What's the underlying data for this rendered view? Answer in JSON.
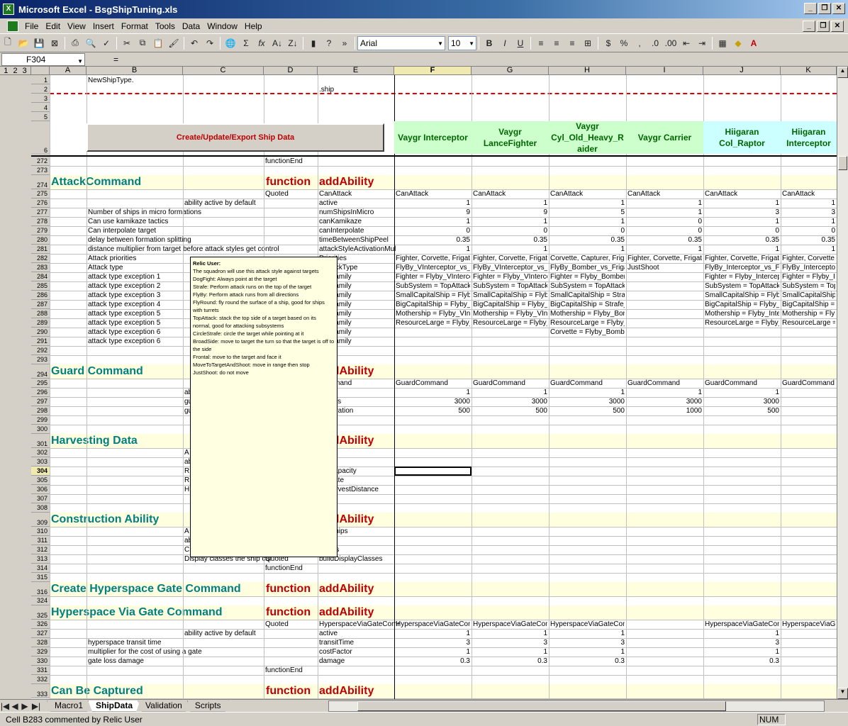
{
  "window": {
    "title": "Microsoft Excel - BsgShipTuning.xls",
    "app_icon": "excel-icon"
  },
  "menu": [
    "File",
    "Edit",
    "View",
    "Insert",
    "Format",
    "Tools",
    "Data",
    "Window",
    "Help"
  ],
  "toolbar": {
    "font": "Arial",
    "size": "10"
  },
  "formula": {
    "namebox": "F304",
    "eq": "="
  },
  "columns": [
    "A",
    "B",
    "C",
    "D",
    "E",
    "F",
    "G",
    "H",
    "I",
    "J",
    "K"
  ],
  "outline_levels": [
    "1",
    "2",
    "3"
  ],
  "header_rows": {
    "r1": "NewShipType.",
    "r2": ".ship"
  },
  "button_label": "Create/Update/Export Ship Data",
  "ships": [
    "Vaygr Interceptor",
    "Vaygr LanceFighter",
    "Vaygr Cyl_Old_Heavy_R aider",
    "Vaygr Carrier",
    "Hiigaran Col_Raptor",
    "Hiigaran Interceptor"
  ],
  "sections": [
    {
      "row": "274",
      "title": "AttackCommand",
      "fn": "function",
      "add": "addAbility"
    },
    {
      "row": "294",
      "title": "Guard Command",
      "fn": "function",
      "add": "addAbility"
    },
    {
      "row": "301",
      "title": "Harvesting Data",
      "fn": "function",
      "add": "addAbility"
    },
    {
      "row": "309",
      "title": "Construction Ability",
      "fn": "function",
      "add": "addAbility"
    },
    {
      "row": "316",
      "title": "Create Hyperspace Gate Command",
      "fn": "function",
      "add": "addAbility"
    },
    {
      "row": "325",
      "title": "Hyperspace Via Gate Command",
      "fn": "function",
      "add": "addAbility"
    },
    {
      "row": "333",
      "title": "Can Be Captured",
      "fn": "function",
      "add": "addAbility"
    }
  ],
  "rows": [
    {
      "n": "272",
      "cells": {
        "D": "functionEnd"
      }
    },
    {
      "n": "273",
      "cells": {}
    },
    {
      "n": "275",
      "cells": {
        "D": "Quoted",
        "E": "CanAttack",
        "F": "CanAttack",
        "G": "CanAttack",
        "H": "CanAttack",
        "I": "CanAttack",
        "J": "CanAttack",
        "K": "CanAttack"
      }
    },
    {
      "n": "276",
      "cells": {
        "C": "ability active by default",
        "E": "active",
        "F": "1",
        "G": "1",
        "H": "1",
        "I": "1",
        "J": "1",
        "K": "1"
      }
    },
    {
      "n": "277",
      "cells": {
        "B": "Number of ships in micro formations",
        "E": "numShipsInMicro",
        "F": "9",
        "G": "9",
        "H": "5",
        "I": "1",
        "J": "3",
        "K": "3"
      }
    },
    {
      "n": "278",
      "cells": {
        "B": "Can use kamikaze tactics",
        "E": "canKamikaze",
        "F": "1",
        "G": "1",
        "H": "1",
        "I": "0",
        "J": "1",
        "K": "1"
      }
    },
    {
      "n": "279",
      "cells": {
        "B": "Can interpolate target",
        "E": "canInterpolate",
        "F": "0",
        "G": "0",
        "H": "0",
        "I": "0",
        "J": "0",
        "K": "0"
      }
    },
    {
      "n": "280",
      "cells": {
        "B": "delay between formation splitting",
        "E": "timeBetweenShipPeel",
        "F": "0.35",
        "G": "0.35",
        "H": "0.35",
        "I": "0.35",
        "J": "0.35",
        "K": "0.35"
      }
    },
    {
      "n": "281",
      "cells": {
        "B": "distance multiplier from target before attack styles get control",
        "E": "attackStyleActivationMul",
        "F": "1",
        "G": "1",
        "H": "1",
        "I": "1",
        "J": "1",
        "K": "1"
      }
    },
    {
      "n": "282",
      "cells": {
        "B": "Attack priorities",
        "E": "Priorities",
        "F": "Fighter, Corvette, Frigate,",
        "G": "Fighter, Corvette, Frigate,",
        "H": "Corvette, Capturer, Frigat",
        "I": "Fighter, Corvette, Frigate,",
        "J": "Fighter, Corvette, Frigate,",
        "K": "Fighter, Corvette,"
      }
    },
    {
      "n": "283",
      "cells": {
        "B": "Attack type",
        "E": "ltAttackType",
        "F": "FlyBy_VInterceptor_vs_F",
        "G": "FlyBy_VInterceptor_vs_F",
        "H": "FlyBy_Bomber_vs_Frigat",
        "I": "JustShoot",
        "J": "FlyBy_Interceptor_vs_Fri",
        "K": "FlyBy_Interceptor"
      }
    },
    {
      "n": "284",
      "cells": {
        "B": "attack type exception 1",
        "E": "tionFamily",
        "F": "Fighter = Flyby_VIntercept",
        "G": "Fighter = Flyby_VIntercept",
        "H": "Fighter = Flyby_Bomber_vs_Fighter",
        "J": "Fighter = Flyby_Interceptor",
        "K": "Fighter = Flyby_In"
      }
    },
    {
      "n": "285",
      "cells": {
        "B": "attack type exception 2",
        "E": "tionFamily",
        "F": "SubSystem = TopAttack_",
        "G": "SubSystem = TopAttack_",
        "H": "SubSystem = TopAttack_Bomber_vs_Subsystem",
        "J": "SubSystem = TopAttack_",
        "K": "SubSystem = Top"
      }
    },
    {
      "n": "286",
      "cells": {
        "B": "attack type exception 3",
        "E": "tionFamily",
        "F": "SmallCapitalShip = Flyby_",
        "G": "SmallCapitalShip = Flyby_",
        "H": "SmallCapitalShip = Strafe_Bomber_vs_Capship",
        "J": "SmallCapitalShip = Flyby_",
        "K": "SmallCapitalShip"
      }
    },
    {
      "n": "287",
      "cells": {
        "B": "attack type exception 4",
        "E": "tionFamily",
        "F": "BigCapitalShip = Flyby_VI",
        "G": "BigCapitalShip = Flyby_VI",
        "H": "BigCapitalShip = Strafe_Bomber_vs_Capship",
        "J": "BigCapitalShip = Flyby_Int",
        "K": "BigCapitalShip ="
      }
    },
    {
      "n": "288",
      "cells": {
        "B": "attack type exception 5",
        "E": "tionFamily",
        "F": "Mothership = Flyby_VInte",
        "G": "Mothership = Flyby_VInte",
        "H": "Mothership = Flyby_Bomber_vs_Mothership",
        "J": "Mothership = Flyby_Interc",
        "K": "Mothership = Flyb"
      }
    },
    {
      "n": "289",
      "cells": {
        "B": "attack type exception 5",
        "E": "tionFamily",
        "F": "ResourceLarge = Flyby_V",
        "G": "ResourceLarge = Flyby_V",
        "H": "ResourceLarge = Flyby_Bomber_vs_ResourceLarge",
        "J": "ResourceLarge = Flyby_In",
        "K": "ResourceLarge ="
      }
    },
    {
      "n": "290",
      "cells": {
        "B": "attack type exception 6",
        "E": "tionFamily",
        "H": "Corvette = Flyby_Bomber_vs_Fighter"
      }
    },
    {
      "n": "291",
      "cells": {
        "B": "attack type exception 6",
        "E": "tionFamily"
      }
    },
    {
      "n": "292",
      "cells": {}
    },
    {
      "n": "293",
      "cells": {}
    },
    {
      "n": "295",
      "cells": {
        "E": "Command",
        "F": "GuardCommand",
        "G": "GuardCommand",
        "H": "GuardCommand",
        "I": "GuardCommand",
        "J": "GuardCommand",
        "K": "GuardCommand"
      }
    },
    {
      "n": "296",
      "cells": {
        "C": "ab",
        "F": "1",
        "G": "1",
        "H": "1",
        "I": "1",
        "J": "1"
      }
    },
    {
      "n": "297",
      "cells": {
        "C": "gu",
        "E": "Radius",
        "F": "3000",
        "G": "3000",
        "H": "3000",
        "I": "3000",
        "J": "3000"
      }
    },
    {
      "n": "298",
      "cells": {
        "C": "gu",
        "E": "Separation",
        "F": "500",
        "G": "500",
        "H": "500",
        "I": "1000",
        "J": "500"
      }
    },
    {
      "n": "299",
      "cells": {}
    },
    {
      "n": "300",
      "cells": {}
    },
    {
      "n": "302",
      "cells": {
        "C": "A",
        "E": "st"
      }
    },
    {
      "n": "303",
      "cells": {
        "C": "ab"
      }
    },
    {
      "n": "304",
      "cells": {
        "C": "R",
        "E": "rceCapacity"
      }
    },
    {
      "n": "305",
      "cells": {
        "C": "R",
        "E": "rceRate"
      }
    },
    {
      "n": "306",
      "cells": {
        "C": "H",
        "E": "ceHarvestDistance"
      }
    },
    {
      "n": "307",
      "cells": {}
    },
    {
      "n": "308",
      "cells": {}
    },
    {
      "n": "310",
      "cells": {
        "C": "A",
        "E": "uildShips"
      }
    },
    {
      "n": "311",
      "cells": {
        "C": "ab"
      }
    },
    {
      "n": "312",
      "cells": {
        "C": "C",
        "E": "lasses"
      }
    },
    {
      "n": "313",
      "cells": {
        "C": "Display classes the ship cal",
        "D": "Quoted",
        "E": "buildDisplayClasses"
      }
    },
    {
      "n": "314",
      "cells": {
        "D": "functionEnd"
      }
    },
    {
      "n": "315",
      "cells": {}
    },
    {
      "n": "324",
      "cells": {}
    },
    {
      "n": "326",
      "cells": {
        "D": "Quoted",
        "E": "HyperspaceViaGateComr",
        "F": "HyperspaceViaGateComr",
        "G": "HyperspaceViaGateComr",
        "H": "HyperspaceViaGateCommand",
        "J": "HyperspaceViaGateComr",
        "K": "HyperspaceViaGa"
      }
    },
    {
      "n": "327",
      "cells": {
        "C": "ability active by default",
        "E": "active",
        "F": "1",
        "G": "1",
        "H": "1",
        "J": "1"
      }
    },
    {
      "n": "328",
      "cells": {
        "B": "hyperspace transit time",
        "E": "transitTime",
        "F": "3",
        "G": "3",
        "H": "3",
        "J": "3"
      }
    },
    {
      "n": "329",
      "cells": {
        "B": "multiplier for the cost of using a gate",
        "E": "costFactor",
        "F": "1",
        "G": "1",
        "H": "1",
        "J": "1"
      }
    },
    {
      "n": "330",
      "cells": {
        "B": "gate loss damage",
        "E": "damage",
        "F": "0.3",
        "G": "0.3",
        "H": "0.3",
        "J": "0.3"
      }
    },
    {
      "n": "331",
      "cells": {
        "D": "functionEnd"
      }
    },
    {
      "n": "332",
      "cells": {}
    }
  ],
  "comment": {
    "author": "Relic User:",
    "lines": [
      "The squadron will use this attack style against targets",
      "DogFight: Always point at the target",
      "Strafe: Perform attack runs on the top of the target",
      "FlyBy: Perform attack runs from all directions",
      "FlyRound: fly round the surface of a ship, good for ships with turrets",
      "TopAttack: stack the top side of a target based on its normal, good for attacking subsystems",
      "CircleStrafe: circle the target while pointing at it",
      "BroadSide: move to target the turn so that the target is off to the side",
      "Frontal: move to the target and face it",
      "MoveToTargetAndShoot: move in range then stop",
      "JustShoot: do not move"
    ]
  },
  "sheet_tabs": [
    "Macro1",
    "ShipData",
    "Validation",
    "Scripts"
  ],
  "status": {
    "text": "Cell B283 commented by Relic User",
    "num": "NUM"
  }
}
